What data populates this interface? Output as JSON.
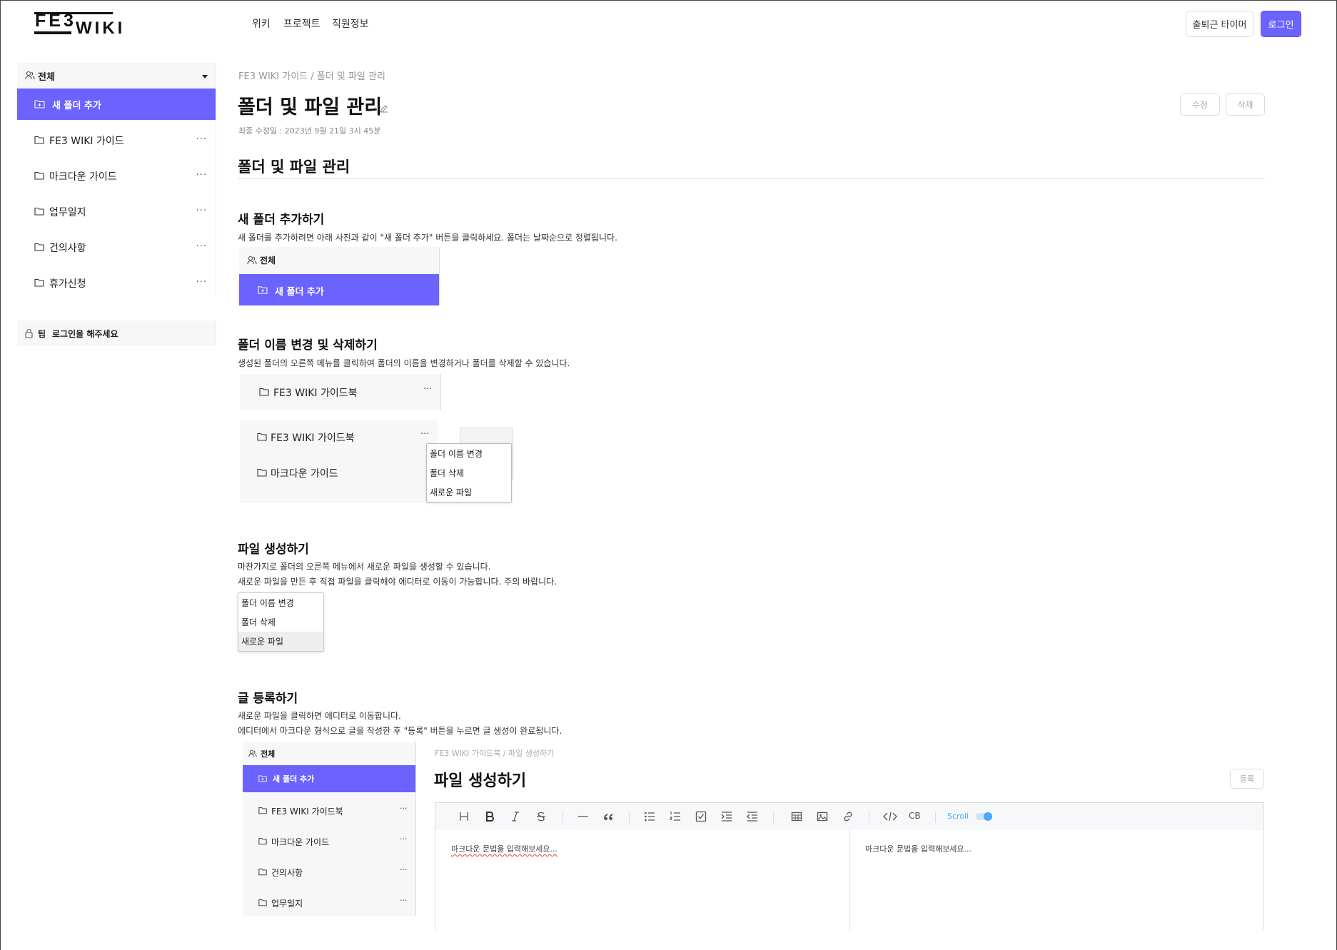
{
  "header": {
    "logo_top": "FE3",
    "logo_bottom": "WIKI",
    "nav": [
      "위키",
      "프로젝트",
      "직원정보"
    ],
    "timer_label": "출퇴근 타이머",
    "login_label": "로그인"
  },
  "sidebar": {
    "all_label": "전체",
    "new_folder": "새 폴더 추가",
    "items": [
      {
        "label": "FE3 WIKI 가이드"
      },
      {
        "label": "마크다운 가이드"
      },
      {
        "label": "업무일지"
      },
      {
        "label": "건의사항"
      },
      {
        "label": "휴가신청"
      }
    ],
    "more": "···",
    "team_label": "팀",
    "team_text": "로그인을 해주세요"
  },
  "main": {
    "breadcrumb": "FE3 WIKI 가이드 / 폴더 및 파일 관리",
    "title": "폴더 및 파일 관리",
    "edit_label": "수정",
    "delete_label": "삭제",
    "last_modified": "최종 수정일 : 2023년 9월 21일 3시 45분",
    "doc_heading": "폴더 및 파일 관리",
    "sections": {
      "new_folder": {
        "heading": "새 폴더 추가하기",
        "desc": "새 폴더를 추가하려면 아래 사진과 같이 \"새 폴더 추가\" 버튼을 클릭하세요. 폴더는 날짜순으로 정렬됩니다.",
        "img_all": "전체",
        "img_new_folder": "새 폴더 추가"
      },
      "rename": {
        "heading": "폴더 이름 변경 및 삭제하기",
        "desc": "생성된 폴더의 오른쪽 메뉴를 클릭하여 폴더의 이름을 변경하거나 폴더를 삭제할 수 있습니다.",
        "img1_label": "FE3 WIKI 가이드북",
        "img2_row1": "FE3 WIKI 가이드북",
        "img2_row2": "마크다운 가이드",
        "menu": [
          "폴더 이름 변경",
          "폴더 삭제",
          "새로운 파일"
        ]
      },
      "create_file": {
        "heading": "파일 생성하기",
        "desc1": "마찬가지로 폴더의 오른쪽 메뉴에서 새로운 파일을 생성할 수 있습니다.",
        "desc2": "새로운 파일을 만든 후 직접 파일을 클릭해야 에디터로 이동이 가능합니다. 주의 바랍니다.",
        "menu": [
          "폴더 이름 변경",
          "폴더 삭제",
          "새로운 파일"
        ]
      },
      "post": {
        "heading": "글 등록하기",
        "desc1": "새로운 파일을 클릭하면 에디터로 이동합니다.",
        "desc2": "에디터에서 마크다운 형식으로 글을 작성한 후 \"등록\" 버튼을 누르면 글 생성이 완료됩니다.",
        "img_all": "전체",
        "img_new_folder": "새 폴더 추가",
        "img_items": [
          "FE3 WIKI 가이드북",
          "마크다운 가이드",
          "건의사항",
          "업무일지"
        ],
        "img_crumb": "FE3 WIKI 가이드북 / 파일 생성하기",
        "img_title": "파일 생성하기",
        "img_register": "등록",
        "toolbar_cb": "CB",
        "toolbar_scroll": "Scroll",
        "editor_placeholder": "마크다운 문법을 입력해보세요...",
        "preview_placeholder": "마크다운 문법을 입력해보세요..."
      }
    }
  },
  "colors": {
    "accent": "#6c63ff",
    "toggle": "#4aa8ff"
  },
  "icons": [
    "user-group-icon",
    "folder-icon",
    "folder-plus-icon",
    "more-icon",
    "lock-icon",
    "pencil-icon",
    "chevron-down-icon",
    "heading-icon",
    "bold-icon",
    "italic-icon",
    "strike-icon",
    "hr-icon",
    "quote-icon",
    "bullet-list-icon",
    "ordered-list-icon",
    "task-icon",
    "indent-icon",
    "outdent-icon",
    "table-icon",
    "image-icon",
    "link-icon",
    "code-icon"
  ]
}
